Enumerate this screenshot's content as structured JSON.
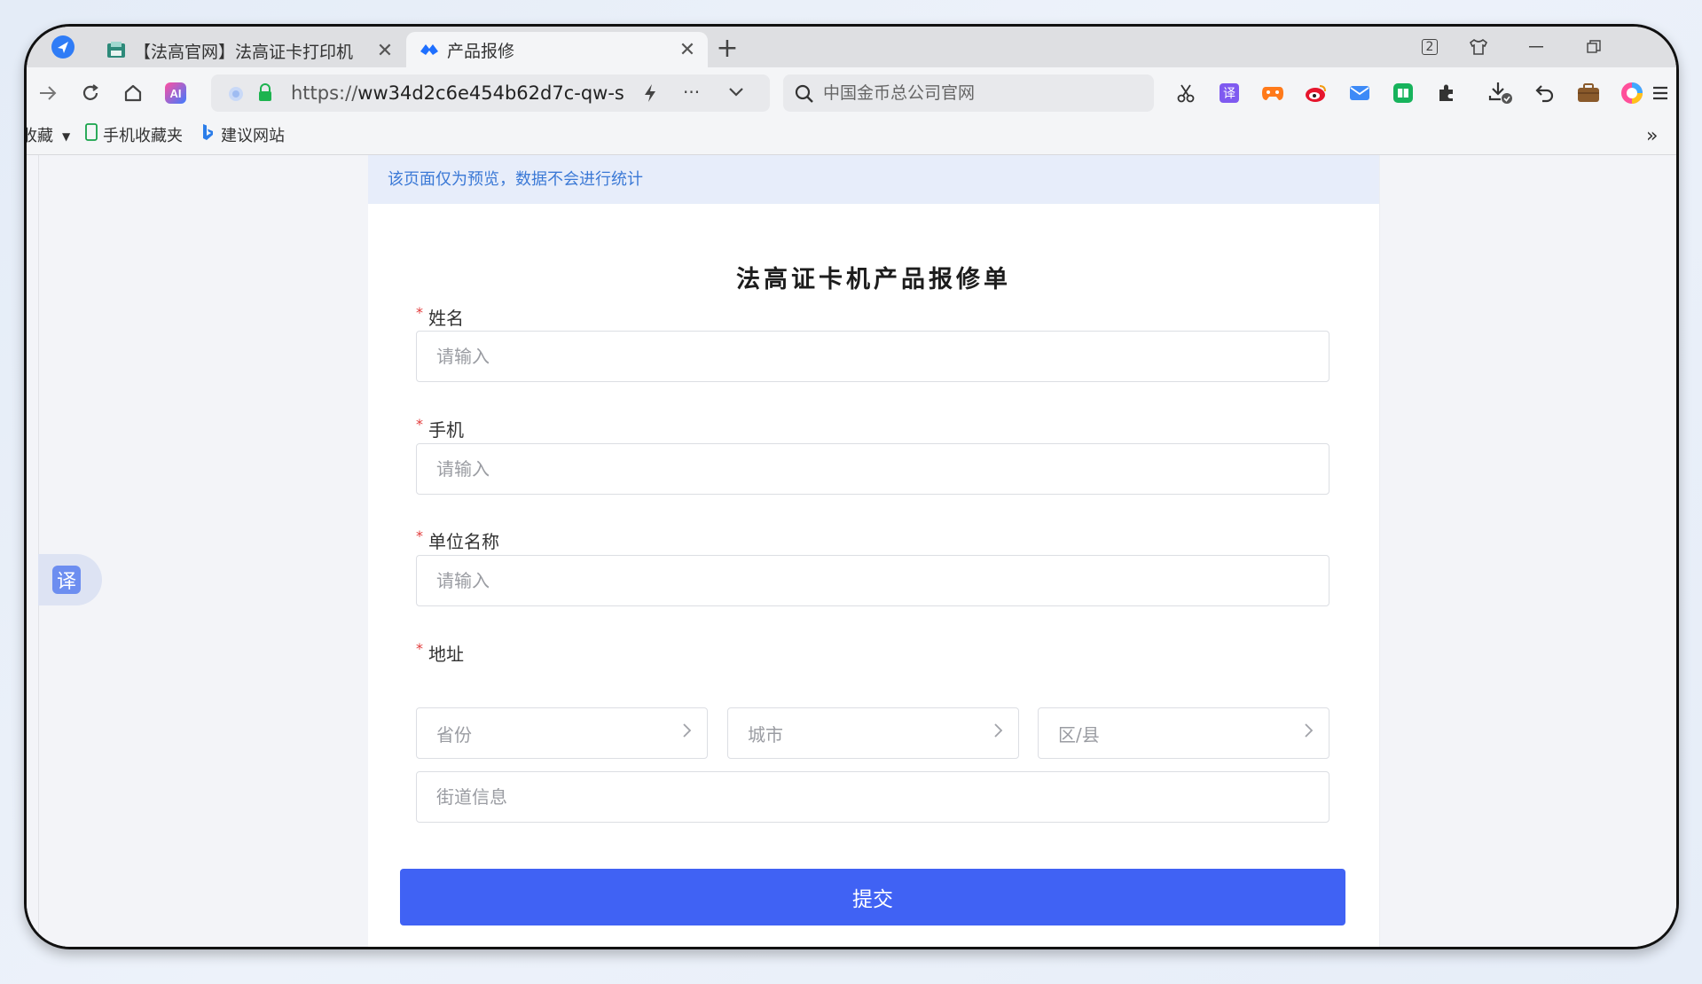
{
  "tabs": [
    {
      "title": "【法高官网】法高证卡打印机",
      "close": "✕"
    },
    {
      "title": "产品报修",
      "close": "✕"
    }
  ],
  "tab_new": "+",
  "window_controls": {
    "tab_count": "2"
  },
  "nav": {
    "url_protocol": "https://",
    "url_rest": "ww34d2c6e454b62d7c-qw-s",
    "more": "···",
    "search_placeholder": "中国金币总公司官网"
  },
  "bookmarks": [
    {
      "label": "收藏"
    },
    {
      "label": "手机收藏夹"
    },
    {
      "label": "建议网站"
    }
  ],
  "bookmarks_more": "»",
  "translate_float": {
    "glyph": "译"
  },
  "page": {
    "notice": "该页面仅为预览，数据不会进行统计",
    "form_title": "法高证卡机产品报修单",
    "fields": {
      "name": {
        "label": "姓名",
        "placeholder": "请输入"
      },
      "phone": {
        "label": "手机",
        "placeholder": "请输入"
      },
      "company": {
        "label": "单位名称",
        "placeholder": "请输入"
      },
      "address": {
        "label": "地址",
        "province": "省份",
        "city": "城市",
        "district": "区/县",
        "street_placeholder": "街道信息"
      }
    },
    "required_mark": "*",
    "submit_label": "提交"
  },
  "colors": {
    "accent": "#4062f4",
    "notice_bg": "#e7edfa",
    "notice_text": "#3b79d6",
    "required": "#e23b3b"
  }
}
